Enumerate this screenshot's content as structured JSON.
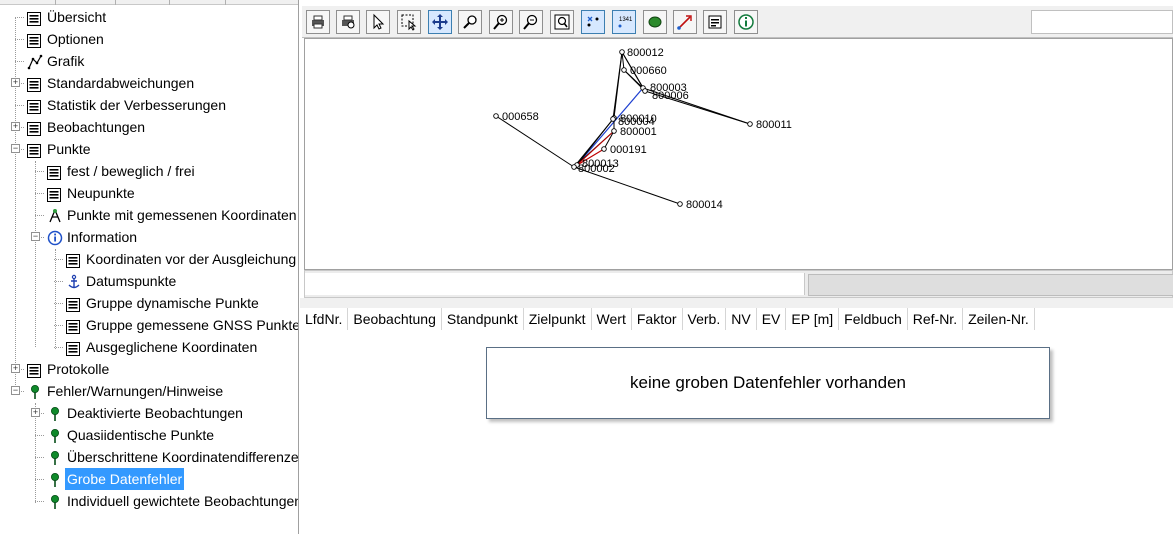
{
  "tree": {
    "items": [
      {
        "label": "Übersicht",
        "icon": "list-icon"
      },
      {
        "label": "Optionen",
        "icon": "list-icon"
      },
      {
        "label": "Grafik",
        "icon": "graph-icon"
      },
      {
        "label": "Standardabweichungen",
        "icon": "list-icon"
      },
      {
        "label": "Statistik der Verbesserungen",
        "icon": "list-icon"
      },
      {
        "label": "Beobachtungen",
        "icon": "list-icon"
      },
      {
        "label": "Punkte",
        "icon": "list-icon"
      },
      {
        "label": "fest / beweglich / frei",
        "icon": "list-icon"
      },
      {
        "label": "Neupunkte",
        "icon": "list-icon"
      },
      {
        "label": "Punkte mit gemessenen Koordinaten",
        "icon": "gnss-icon"
      },
      {
        "label": "Information",
        "icon": "info-icon"
      },
      {
        "label": "Koordinaten vor der Ausgleichung",
        "icon": "list-icon"
      },
      {
        "label": "Datumspunkte",
        "icon": "anchor-icon"
      },
      {
        "label": "Gruppe dynamische Punkte",
        "icon": "list-icon"
      },
      {
        "label": "Gruppe gemessene GNSS Punkte",
        "icon": "list-icon"
      },
      {
        "label": "Ausgeglichene Koordinaten",
        "icon": "list-icon"
      },
      {
        "label": "Protokolle",
        "icon": "list-icon"
      },
      {
        "label": "Fehler/Warnungen/Hinweise",
        "icon": "pin-icon"
      },
      {
        "label": "Deaktivierte Beobachtungen",
        "icon": "pin-icon"
      },
      {
        "label": "Quasiidentische Punkte",
        "icon": "pin-icon"
      },
      {
        "label": "Überschrittene Koordinatendifferenzen",
        "icon": "pin-icon"
      },
      {
        "label": "Grobe Datenfehler",
        "icon": "pin-icon",
        "selected": true
      },
      {
        "label": "Individuell gewichtete Beobachtungen",
        "icon": "pin-icon"
      }
    ],
    "selected_color": "#3399ff"
  },
  "toolbar": {
    "buttons": [
      {
        "icon": "print-icon"
      },
      {
        "icon": "print-preview-icon"
      },
      {
        "icon": "pointer-icon"
      },
      {
        "icon": "select-rect-icon"
      },
      {
        "icon": "pan-icon",
        "active": true
      },
      {
        "icon": "zoom-realtime-icon"
      },
      {
        "icon": "zoom-in-icon"
      },
      {
        "icon": "zoom-out-icon"
      },
      {
        "icon": "zoom-extent-icon"
      },
      {
        "icon": "show-points-icon",
        "active": true
      },
      {
        "icon": "point-numbers-icon",
        "active": true
      },
      {
        "icon": "ellipse-icon"
      },
      {
        "icon": "vector-icon"
      },
      {
        "icon": "properties-icon"
      },
      {
        "icon": "info-icon"
      }
    ]
  },
  "graphic": {
    "points": [
      {
        "name": "800012"
      },
      {
        "name": "000660"
      },
      {
        "name": "800003"
      },
      {
        "name": "800006"
      },
      {
        "name": "000658"
      },
      {
        "name": "800010"
      },
      {
        "name": "800004"
      },
      {
        "name": "800011"
      },
      {
        "name": "800001"
      },
      {
        "name": "000191"
      },
      {
        "name": "800013"
      },
      {
        "name": "800002"
      },
      {
        "name": "800014"
      }
    ],
    "line_color": "#000000",
    "highlight_line_color": "#c00000",
    "accent_line_color": "#1e3fd0"
  },
  "table": {
    "columns": [
      "LfdNr.",
      "Beobachtung",
      "Standpunkt",
      "Zielpunkt",
      "Wert",
      "Faktor",
      "Verb.",
      "NV",
      "EV",
      "EP [m]",
      "Feldbuch",
      "Ref-Nr.",
      "Zeilen-Nr."
    ]
  },
  "message": "keine groben Datenfehler vorhanden"
}
